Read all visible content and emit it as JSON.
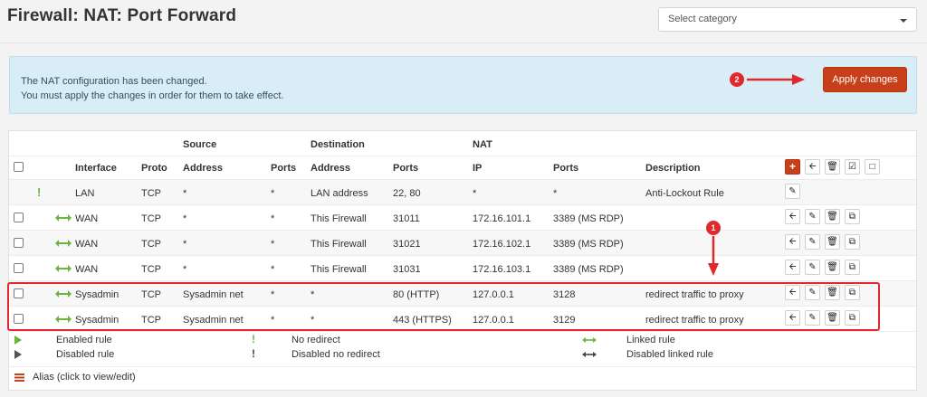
{
  "header": {
    "title": "Firewall: NAT: Port Forward",
    "category_placeholder": "Select category"
  },
  "alert": {
    "line1": "The NAT configuration has been changed.",
    "line2": "You must apply the changes in order for them to take effect.",
    "apply_label": "Apply changes",
    "callout_apply": "2",
    "callout_rules": "1"
  },
  "table": {
    "group_headers": {
      "source": "Source",
      "destination": "Destination",
      "nat": "NAT"
    },
    "columns": [
      "Interface",
      "Proto",
      "Address",
      "Ports",
      "Address",
      "Ports",
      "IP",
      "Ports",
      "Description"
    ],
    "rows": [
      {
        "interface": "LAN",
        "proto": "TCP",
        "src_addr": "*",
        "src_ports": "*",
        "dst_addr": "LAN address",
        "dst_ports": "22, 80",
        "nat_ip": "*",
        "nat_ports": "*",
        "description": "Anti-Lockout Rule"
      },
      {
        "interface": "WAN",
        "proto": "TCP",
        "src_addr": "*",
        "src_ports": "*",
        "dst_addr": "This Firewall",
        "dst_ports": "31011",
        "nat_ip": "172.16.101.1",
        "nat_ports": "3389 (MS RDP)",
        "description": ""
      },
      {
        "interface": "WAN",
        "proto": "TCP",
        "src_addr": "*",
        "src_ports": "*",
        "dst_addr": "This Firewall",
        "dst_ports": "31021",
        "nat_ip": "172.16.102.1",
        "nat_ports": "3389 (MS RDP)",
        "description": ""
      },
      {
        "interface": "WAN",
        "proto": "TCP",
        "src_addr": "*",
        "src_ports": "*",
        "dst_addr": "This Firewall",
        "dst_ports": "31031",
        "nat_ip": "172.16.103.1",
        "nat_ports": "3389 (MS RDP)",
        "description": ""
      },
      {
        "interface": "Sysadmin",
        "proto": "TCP",
        "src_addr": "Sysadmin net",
        "src_ports": "*",
        "dst_addr": "*",
        "dst_ports": "80 (HTTP)",
        "nat_ip": "127.0.0.1",
        "nat_ports": "3128",
        "description": "redirect traffic to proxy"
      },
      {
        "interface": "Sysadmin",
        "proto": "TCP",
        "src_addr": "Sysadmin net",
        "src_ports": "*",
        "dst_addr": "*",
        "dst_ports": "443 (HTTPS)",
        "nat_ip": "127.0.0.1",
        "nat_ports": "3129",
        "description": "redirect traffic to proxy"
      }
    ]
  },
  "legend": {
    "enabled_rule": "Enabled rule",
    "disabled_rule": "Disabled rule",
    "no_redirect": "No redirect",
    "disabled_no_redirect": "Disabled no redirect",
    "linked_rule": "Linked rule",
    "disabled_linked_rule": "Disabled linked rule",
    "alias": "Alias (click to view/edit)"
  },
  "icons": {
    "add": "plus-icon",
    "move": "arrow-left-icon",
    "delete": "trash-icon",
    "toggle": "check-square-icon",
    "select": "square-icon",
    "edit": "pencil-icon",
    "clone": "clone-icon"
  },
  "colors": {
    "accent": "#c8401a",
    "alert_bg": "#d9edf7",
    "enabled": "#6db33f",
    "callout": "#e0292c"
  }
}
